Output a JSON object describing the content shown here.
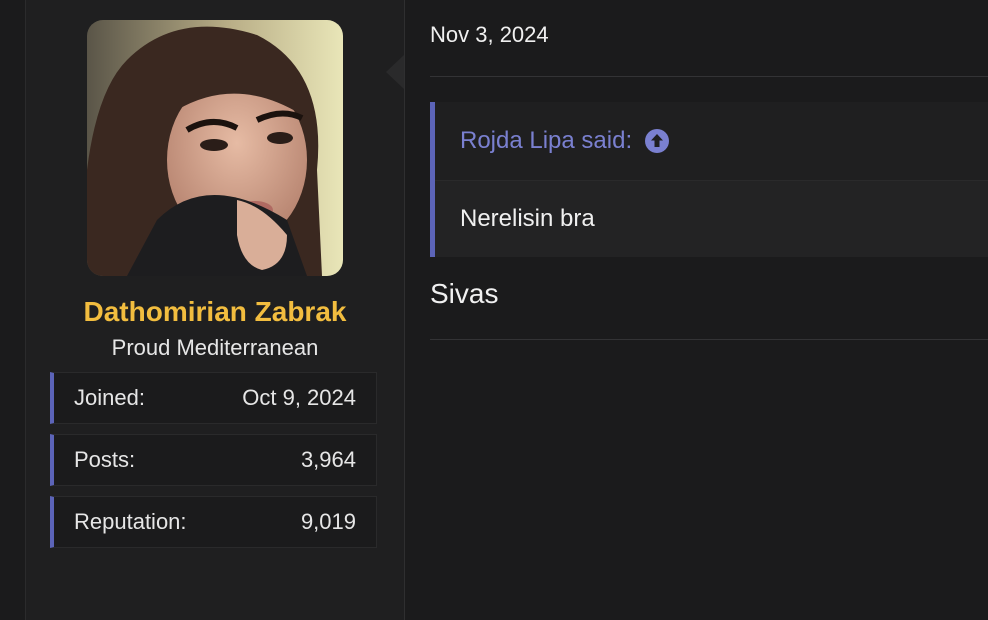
{
  "user": {
    "name": "Dathomirian Zabrak",
    "title": "Proud Mediterranean",
    "stats": [
      {
        "label": "Joined:",
        "value": "Oct 9, 2024"
      },
      {
        "label": "Posts:",
        "value": "3,964"
      },
      {
        "label": "Reputation:",
        "value": "9,019"
      }
    ]
  },
  "post": {
    "date": "Nov 3, 2024",
    "quote": {
      "author_said": "Rojda Lipa said:",
      "jump_icon": "arrow-up-circle-icon",
      "text": "Nerelisin bra"
    },
    "body": "Sivas"
  },
  "colors": {
    "username": "#f2bd3f",
    "accent": "#5c64b8",
    "quote_author": "#7a80d0",
    "background": "#1b1b1c"
  }
}
